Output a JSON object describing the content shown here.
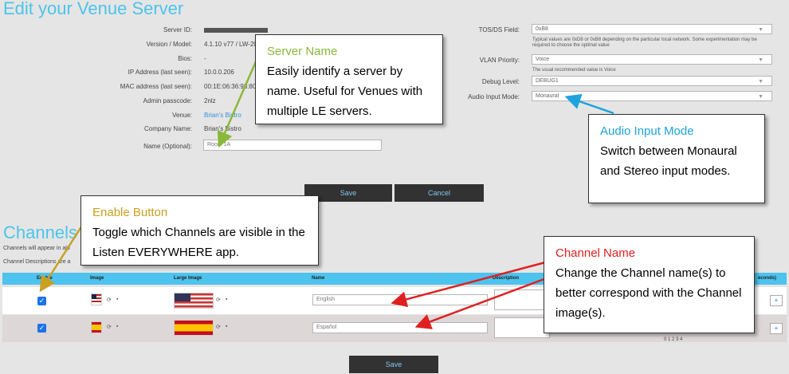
{
  "page": {
    "title": "Edit your Venue Server"
  },
  "server_info": {
    "rows": [
      {
        "label": "Server ID:",
        "value": ""
      },
      {
        "label": "Version / Model:",
        "value": "4.1.10 v77 / LW-20"
      },
      {
        "label": "Bios:",
        "value": "-"
      },
      {
        "label": "IP Address (last seen):",
        "value": "10.0.0.206"
      },
      {
        "label": "MAC address (last seen):",
        "value": "00:1E:06:36:93:80"
      },
      {
        "label": "Admin passcode:",
        "value": "2nlz"
      },
      {
        "label": "Venue:",
        "value": "Brian's Bistro"
      },
      {
        "label": "Company Name:",
        "value": "Brian's Bistro"
      }
    ],
    "name_label": "Name (Optional):",
    "name_value": "Room 1A"
  },
  "settings": {
    "tos_label": "TOS/DS Field:",
    "tos_value": "0xB8",
    "tos_hint": "Typical values are 0xD8 or 0xB8 depending on the particular local network. Some experimentation may be required to choose the optimal value",
    "vlan_label": "VLAN Priority:",
    "vlan_value": "Voice",
    "vlan_hint": "The usual recommended value is Voice",
    "debug_label": "Debug Level:",
    "debug_value": "DEBUG1",
    "audio_label": "Audio Input Mode:",
    "audio_value": "Monaural"
  },
  "buttons": {
    "save": "Save",
    "cancel": "Cancel",
    "bottom_save": "Save"
  },
  "channels": {
    "title": "Channels",
    "note1": "Channels will appear in alp",
    "note2": "Channel Descriptions are a",
    "headers": {
      "enable": "Enable",
      "image": "Image",
      "large_image": "Large Image",
      "name": "Name",
      "description": "Description",
      "seconds": "econds)"
    },
    "rows": [
      {
        "name": "English",
        "enabled": true,
        "flag": "us-flag-icon"
      },
      {
        "name": "Español",
        "enabled": true,
        "flag": "spain-flag-icon"
      }
    ],
    "scale": "0 1 2 3 4"
  },
  "callouts": {
    "server_name": {
      "heading": "Server Name",
      "body": "Easily identify a server by name. Useful for Venues with multiple LE servers.",
      "color": "#8ab83a"
    },
    "audio_mode": {
      "heading": "Audio Input Mode",
      "body": "Switch between Monaural and Stereo input modes.",
      "color": "#1fa3dc"
    },
    "enable_button": {
      "heading": "Enable Button",
      "body": "Toggle which Channels are visible in the Listen EVERYWHERE app.",
      "color": "#c9a020"
    },
    "channel_name": {
      "heading": "Channel Name",
      "body": "Change the Channel name(s) to better correspond with the Channel image(s).",
      "color": "#e02020"
    }
  }
}
